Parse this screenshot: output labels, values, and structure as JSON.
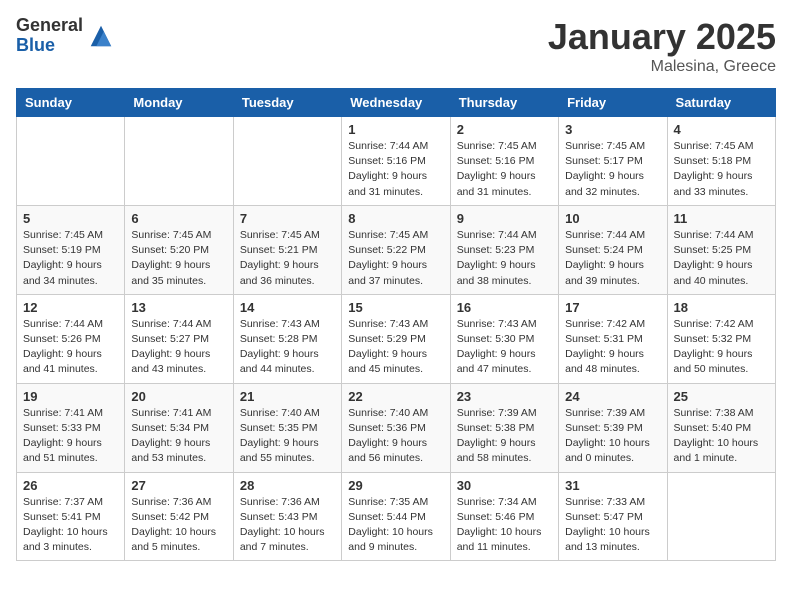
{
  "header": {
    "logo_general": "General",
    "logo_blue": "Blue",
    "month_year": "January 2025",
    "location": "Malesina, Greece"
  },
  "days_of_week": [
    "Sunday",
    "Monday",
    "Tuesday",
    "Wednesday",
    "Thursday",
    "Friday",
    "Saturday"
  ],
  "weeks": [
    [
      {
        "day": "",
        "info": ""
      },
      {
        "day": "",
        "info": ""
      },
      {
        "day": "",
        "info": ""
      },
      {
        "day": "1",
        "info": "Sunrise: 7:44 AM\nSunset: 5:16 PM\nDaylight: 9 hours\nand 31 minutes."
      },
      {
        "day": "2",
        "info": "Sunrise: 7:45 AM\nSunset: 5:16 PM\nDaylight: 9 hours\nand 31 minutes."
      },
      {
        "day": "3",
        "info": "Sunrise: 7:45 AM\nSunset: 5:17 PM\nDaylight: 9 hours\nand 32 minutes."
      },
      {
        "day": "4",
        "info": "Sunrise: 7:45 AM\nSunset: 5:18 PM\nDaylight: 9 hours\nand 33 minutes."
      }
    ],
    [
      {
        "day": "5",
        "info": "Sunrise: 7:45 AM\nSunset: 5:19 PM\nDaylight: 9 hours\nand 34 minutes."
      },
      {
        "day": "6",
        "info": "Sunrise: 7:45 AM\nSunset: 5:20 PM\nDaylight: 9 hours\nand 35 minutes."
      },
      {
        "day": "7",
        "info": "Sunrise: 7:45 AM\nSunset: 5:21 PM\nDaylight: 9 hours\nand 36 minutes."
      },
      {
        "day": "8",
        "info": "Sunrise: 7:45 AM\nSunset: 5:22 PM\nDaylight: 9 hours\nand 37 minutes."
      },
      {
        "day": "9",
        "info": "Sunrise: 7:44 AM\nSunset: 5:23 PM\nDaylight: 9 hours\nand 38 minutes."
      },
      {
        "day": "10",
        "info": "Sunrise: 7:44 AM\nSunset: 5:24 PM\nDaylight: 9 hours\nand 39 minutes."
      },
      {
        "day": "11",
        "info": "Sunrise: 7:44 AM\nSunset: 5:25 PM\nDaylight: 9 hours\nand 40 minutes."
      }
    ],
    [
      {
        "day": "12",
        "info": "Sunrise: 7:44 AM\nSunset: 5:26 PM\nDaylight: 9 hours\nand 41 minutes."
      },
      {
        "day": "13",
        "info": "Sunrise: 7:44 AM\nSunset: 5:27 PM\nDaylight: 9 hours\nand 43 minutes."
      },
      {
        "day": "14",
        "info": "Sunrise: 7:43 AM\nSunset: 5:28 PM\nDaylight: 9 hours\nand 44 minutes."
      },
      {
        "day": "15",
        "info": "Sunrise: 7:43 AM\nSunset: 5:29 PM\nDaylight: 9 hours\nand 45 minutes."
      },
      {
        "day": "16",
        "info": "Sunrise: 7:43 AM\nSunset: 5:30 PM\nDaylight: 9 hours\nand 47 minutes."
      },
      {
        "day": "17",
        "info": "Sunrise: 7:42 AM\nSunset: 5:31 PM\nDaylight: 9 hours\nand 48 minutes."
      },
      {
        "day": "18",
        "info": "Sunrise: 7:42 AM\nSunset: 5:32 PM\nDaylight: 9 hours\nand 50 minutes."
      }
    ],
    [
      {
        "day": "19",
        "info": "Sunrise: 7:41 AM\nSunset: 5:33 PM\nDaylight: 9 hours\nand 51 minutes."
      },
      {
        "day": "20",
        "info": "Sunrise: 7:41 AM\nSunset: 5:34 PM\nDaylight: 9 hours\nand 53 minutes."
      },
      {
        "day": "21",
        "info": "Sunrise: 7:40 AM\nSunset: 5:35 PM\nDaylight: 9 hours\nand 55 minutes."
      },
      {
        "day": "22",
        "info": "Sunrise: 7:40 AM\nSunset: 5:36 PM\nDaylight: 9 hours\nand 56 minutes."
      },
      {
        "day": "23",
        "info": "Sunrise: 7:39 AM\nSunset: 5:38 PM\nDaylight: 9 hours\nand 58 minutes."
      },
      {
        "day": "24",
        "info": "Sunrise: 7:39 AM\nSunset: 5:39 PM\nDaylight: 10 hours\nand 0 minutes."
      },
      {
        "day": "25",
        "info": "Sunrise: 7:38 AM\nSunset: 5:40 PM\nDaylight: 10 hours\nand 1 minute."
      }
    ],
    [
      {
        "day": "26",
        "info": "Sunrise: 7:37 AM\nSunset: 5:41 PM\nDaylight: 10 hours\nand 3 minutes."
      },
      {
        "day": "27",
        "info": "Sunrise: 7:36 AM\nSunset: 5:42 PM\nDaylight: 10 hours\nand 5 minutes."
      },
      {
        "day": "28",
        "info": "Sunrise: 7:36 AM\nSunset: 5:43 PM\nDaylight: 10 hours\nand 7 minutes."
      },
      {
        "day": "29",
        "info": "Sunrise: 7:35 AM\nSunset: 5:44 PM\nDaylight: 10 hours\nand 9 minutes."
      },
      {
        "day": "30",
        "info": "Sunrise: 7:34 AM\nSunset: 5:46 PM\nDaylight: 10 hours\nand 11 minutes."
      },
      {
        "day": "31",
        "info": "Sunrise: 7:33 AM\nSunset: 5:47 PM\nDaylight: 10 hours\nand 13 minutes."
      },
      {
        "day": "",
        "info": ""
      }
    ]
  ]
}
